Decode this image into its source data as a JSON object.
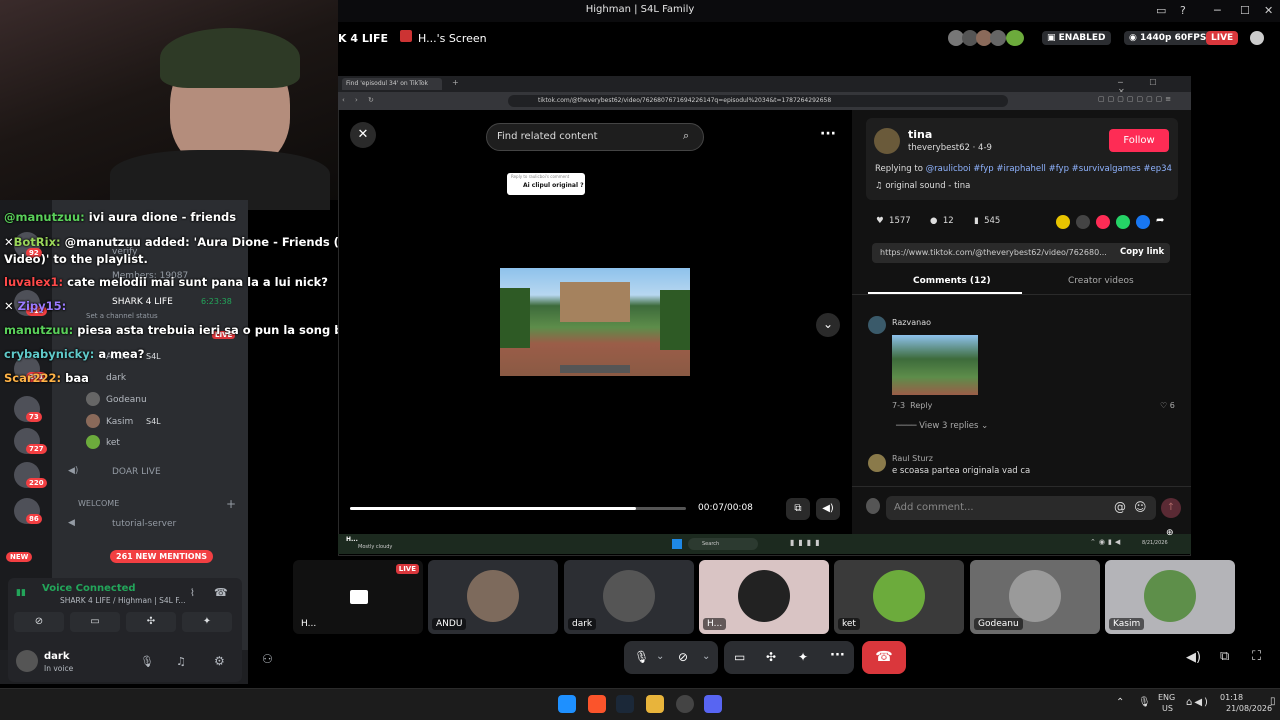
{
  "window": {
    "title": "Highman | S4L Family"
  },
  "stream": {
    "channel": "K 4 LIFE",
    "screen_name": "H...'s Screen",
    "enabled": "ENABLED",
    "quality": "1440p 60FPS",
    "live": "LIVE"
  },
  "chat": [
    {
      "name": "@manutzuu:",
      "text": "ivi aura dione - friends",
      "color": "#5ad05a"
    },
    {
      "name": "BotRix:",
      "text": "@manutzuu added: 'Aura Dione - Friends (Official Video)' to the playlist.",
      "color": "#9ad65a"
    },
    {
      "name": "luvalex1:",
      "text": "cate melodii mai sunt pana la a lui nick?",
      "color": "#ff4a4a"
    },
    {
      "name": "Zipy15:",
      "text": "",
      "color": "#9b7bff"
    },
    {
      "name": "manutzuu:",
      "text": "piesa asta trebuia ieri sa o pun la song battle",
      "color": "#5ad05a"
    },
    {
      "name": "crybabynicky:",
      "text": "a mea?",
      "color": "#5fc9c9"
    },
    {
      "name": "Scar222:",
      "text": "baa",
      "color": "#ffb347"
    }
  ],
  "sidebar": {
    "channels": [
      "verify",
      "Members: 19087",
      "SHARK 4 LIFE",
      "Set a channel status",
      "Andu",
      "dark",
      "Godeanu",
      "Kasim",
      "ket",
      "DOAR LIVE",
      "WELCOME",
      "tutorial-server"
    ],
    "live_badge": "LIVE",
    "timer": "6:23:38",
    "mentions": "261 NEW MENTIONS",
    "new_badge": "NEW",
    "tag": "S4L",
    "server_badges": [
      "92",
      "112",
      "261",
      "73",
      "727",
      "220",
      "86"
    ]
  },
  "voice": {
    "status": "Voice Connected",
    "channel": "SHARK 4 LIFE / Highman | S4L F...",
    "user": "dark",
    "user_status": "In voice"
  },
  "browser": {
    "tab": "Find 'episodul 34' on TikTok",
    "url": "tiktok.com/@theverybest62/video/7626807671694226147q=episodul%2034&t=1787264292658"
  },
  "tiktok": {
    "search_placeholder": "Find related content",
    "reply_to": "Ai clipul original ?",
    "reply_hdr": "Reply to raulicboi's comment",
    "time": "00:07/00:08",
    "author": "tina",
    "handle": "theverybest62 · 4-9",
    "follow": "Follow",
    "caption_prefix": "Replying to",
    "caption": "@raulicboi #fyp #iraphahell #fyp #survivalgames #ep34",
    "sound": "original sound - tina",
    "likes": "1577",
    "comments": "12",
    "saves": "545",
    "link": "https://www.tiktok.com/@theverybest62/video/762680...",
    "copy_link": "Copy link",
    "tab_comments": "Comments (12)",
    "tab_creator": "Creator videos",
    "c1_user": "Razvanao",
    "c1_date": "7-3",
    "c1_reply": "Reply",
    "c1_likes": "6",
    "view_replies": "View 3 replies",
    "c2_user": "Raul Sturz",
    "c2_text": "e scoasa partea originala vad ca",
    "add_comment": "Add comment..."
  },
  "inner_taskbar": {
    "weather": "Mostly cloudy",
    "search": "Search",
    "date": "8/21/2026"
  },
  "tiles": [
    {
      "name": "H..."
    },
    {
      "name": "ANDU"
    },
    {
      "name": "dark"
    },
    {
      "name": "H..."
    },
    {
      "name": "ket"
    },
    {
      "name": "Godeanu"
    },
    {
      "name": "Kasim"
    }
  ],
  "taskbar": {
    "lang": "ENG",
    "region": "US",
    "time": "01:18",
    "date": "21/08/2026"
  }
}
